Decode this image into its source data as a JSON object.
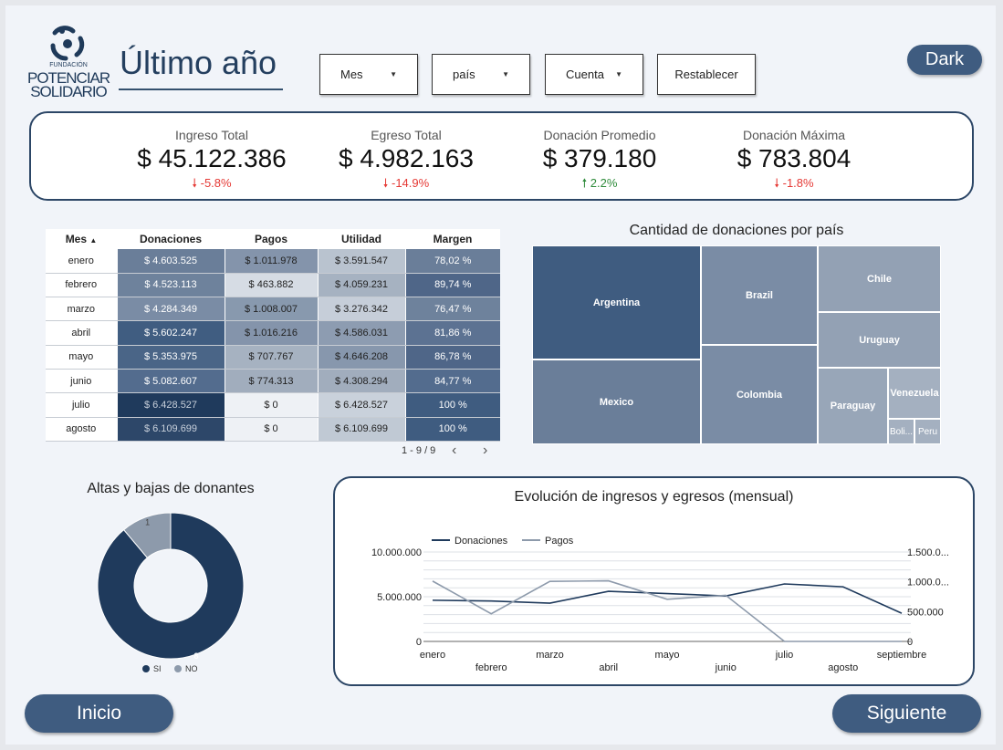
{
  "logo": {
    "line1": "FUNDACIÓN",
    "line2": "POTENCIAR",
    "line3": "SOLIDARIO"
  },
  "title": "Último año",
  "filters": [
    {
      "label": "Mes"
    },
    {
      "label": "país"
    },
    {
      "label": "Cuenta"
    }
  ],
  "reset_label": "Restablecer",
  "dark_label": "Dark",
  "kpis": [
    {
      "label": "Ingreso Total",
      "value": "$ 45.122.386",
      "delta": "-5.8%",
      "trend": "down"
    },
    {
      "label": "Egreso Total",
      "value": "$ 4.982.163",
      "delta": "-14.9%",
      "trend": "down"
    },
    {
      "label": "Donación Promedio",
      "value": "$ 379.180",
      "delta": "2.2%",
      "trend": "up"
    },
    {
      "label": "Donación Máxima",
      "value": "$ 783.804",
      "delta": "-1.8%",
      "trend": "down"
    }
  ],
  "table": {
    "headers": [
      "Mes",
      "Donaciones",
      "Pagos",
      "Utilidad",
      "Margen"
    ],
    "sort_arrow": "▲",
    "rows": [
      [
        "enero",
        "$ 4.603.525",
        "$ 1.011.978",
        "$ 3.591.547",
        "78,02 %"
      ],
      [
        "febrero",
        "$ 4.523.113",
        "$ 463.882",
        "$ 4.059.231",
        "89,74 %"
      ],
      [
        "marzo",
        "$ 4.284.349",
        "$ 1.008.007",
        "$ 3.276.342",
        "76,47 %"
      ],
      [
        "abril",
        "$ 5.602.247",
        "$ 1.016.216",
        "$ 4.586.031",
        "81,86 %"
      ],
      [
        "mayo",
        "$ 5.353.975",
        "$ 707.767",
        "$ 4.646.208",
        "86,78 %"
      ],
      [
        "junio",
        "$ 5.082.607",
        "$ 774.313",
        "$ 4.308.294",
        "84,77 %"
      ],
      [
        "julio",
        "$ 6.428.527",
        "$ 0",
        "$ 6.428.527",
        "100 %"
      ],
      [
        "agosto",
        "$ 6.109.699",
        "$ 0",
        "$ 6.109.699",
        "100 %"
      ]
    ],
    "pager": "1 - 9 / 9",
    "prev": "‹",
    "next": "›"
  },
  "treemap": {
    "title": "Cantidad de donaciones por país",
    "items": [
      "Argentina",
      "Mexico",
      "Brazil",
      "Colombia",
      "Chile",
      "Uruguay",
      "Paraguay",
      "Venezuela",
      "Boli...",
      "Peru"
    ]
  },
  "donut": {
    "title": "Altas y bajas de donantes",
    "slices": [
      {
        "label": "SI",
        "value": 8,
        "color": "#1f3a5c"
      },
      {
        "label": "NO",
        "value": 1,
        "color": "#8d9aab"
      }
    ]
  },
  "chart_data": {
    "type": "line",
    "title": "Evolución de ingresos y egresos (mensual)",
    "categories": [
      "enero",
      "febrero",
      "marzo",
      "abril",
      "mayo",
      "junio",
      "julio",
      "agosto",
      "septiembre"
    ],
    "series": [
      {
        "name": "Donaciones",
        "axis": "left",
        "color": "#1f3a5c",
        "values": [
          4603525,
          4523113,
          4284349,
          5602247,
          5353975,
          5082607,
          6428527,
          6109699,
          3150000
        ]
      },
      {
        "name": "Pagos",
        "axis": "right",
        "color": "#8d9aab",
        "values": [
          1011978,
          463882,
          1008007,
          1016216,
          707767,
          774313,
          0,
          0,
          0
        ]
      }
    ],
    "left_ticks": [
      "10.000.000",
      "5.000.000",
      "0"
    ],
    "right_ticks": [
      "1.500.0...",
      "1.000.0...",
      "500.000",
      "0"
    ],
    "ylim_left": [
      0,
      10000000
    ],
    "ylim_right": [
      0,
      1500000
    ]
  },
  "nav": {
    "home": "Inicio",
    "next": "Siguiente"
  },
  "colors": {
    "primary": "#3f5c80",
    "dark_navy": "#1f3a5c",
    "accent_light": "#8d9aab"
  }
}
